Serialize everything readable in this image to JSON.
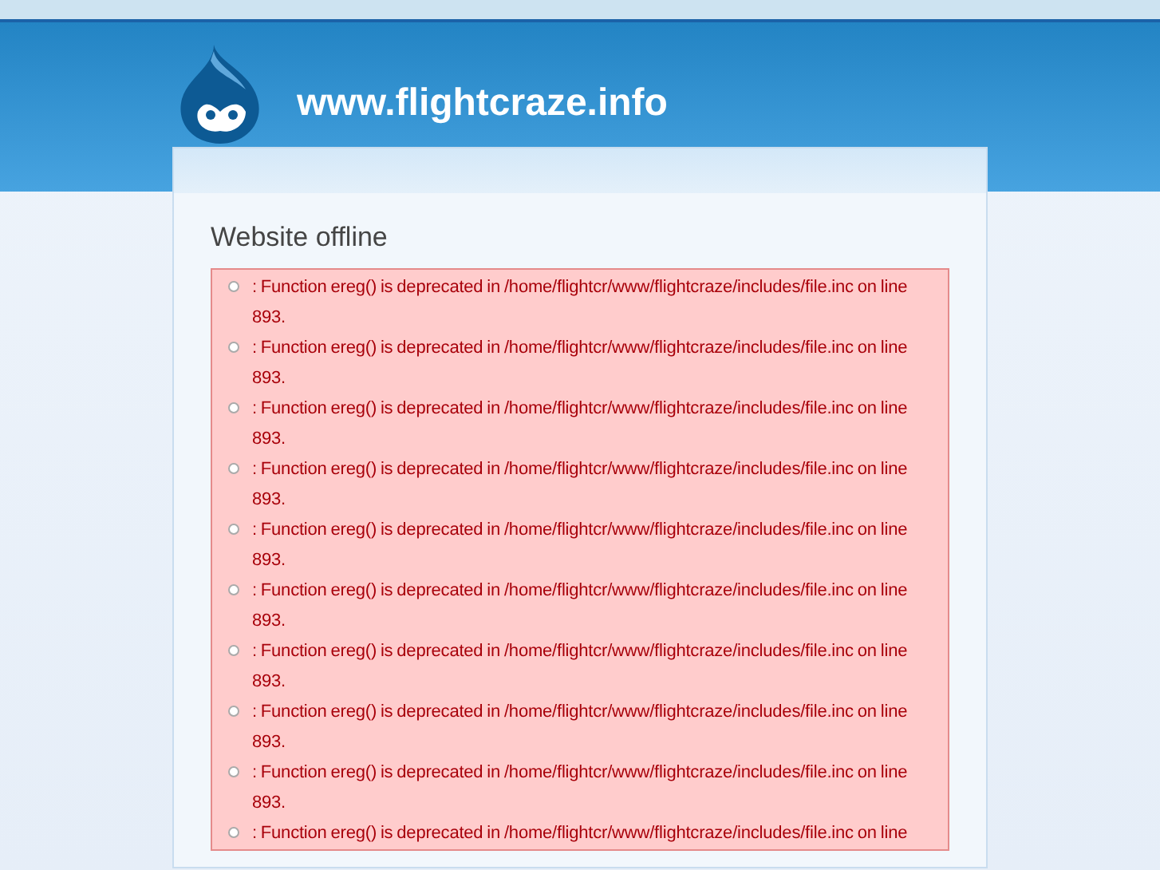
{
  "site": {
    "name": "www.flightcraze.info"
  },
  "page": {
    "title": "Website offline"
  },
  "messages": [
    {
      "text": ": Function ereg() is deprecated in /home/flightcr/www/flightcraze/includes/file.inc on line 893."
    },
    {
      "text": ": Function ereg() is deprecated in /home/flightcr/www/flightcraze/includes/file.inc on line 893."
    },
    {
      "text": ": Function ereg() is deprecated in /home/flightcr/www/flightcraze/includes/file.inc on line 893."
    },
    {
      "text": ": Function ereg() is deprecated in /home/flightcr/www/flightcraze/includes/file.inc on line 893."
    },
    {
      "text": ": Function ereg() is deprecated in /home/flightcr/www/flightcraze/includes/file.inc on line 893."
    },
    {
      "text": ": Function ereg() is deprecated in /home/flightcr/www/flightcraze/includes/file.inc on line 893."
    },
    {
      "text": ": Function ereg() is deprecated in /home/flightcr/www/flightcraze/includes/file.inc on line 893."
    },
    {
      "text": ": Function ereg() is deprecated in /home/flightcr/www/flightcraze/includes/file.inc on line 893."
    },
    {
      "text": ": Function ereg() is deprecated in /home/flightcr/www/flightcraze/includes/file.inc on line 893."
    },
    {
      "text": ": Function ereg() is deprecated in /home/flightcr/www/flightcraze/includes/file.inc on line"
    }
  ]
}
